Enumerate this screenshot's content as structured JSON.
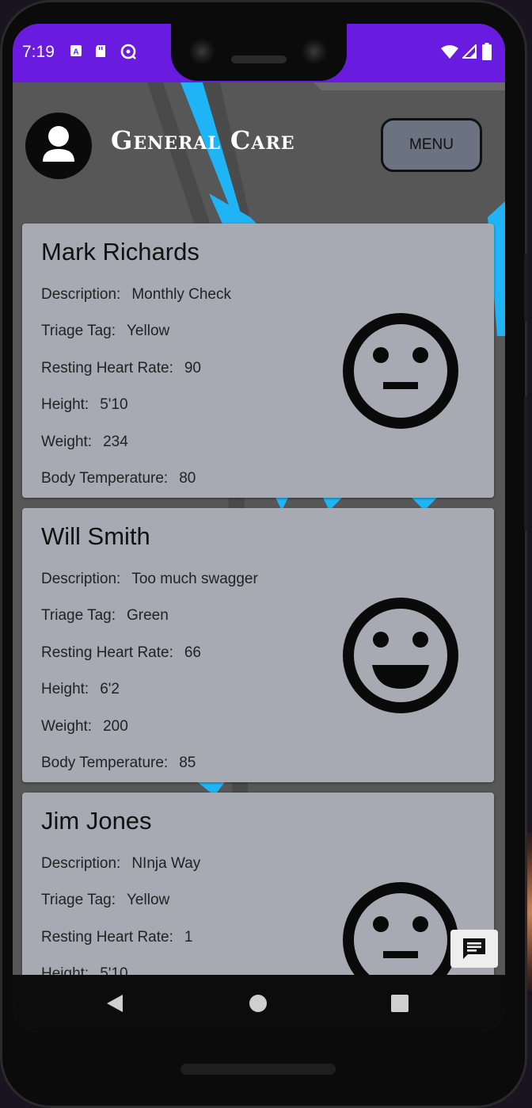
{
  "status": {
    "time": "7:19"
  },
  "header": {
    "title": "General Care",
    "menu_label": "MENU"
  },
  "labels": {
    "description": "Description:",
    "triage": "Triage Tag:",
    "heart_rate": "Resting Heart Rate:",
    "height": "Height:",
    "weight": "Weight:",
    "temperature": "Body Temperature:"
  },
  "patients": [
    {
      "name": "Mark Richards",
      "description": "Monthly Check",
      "triage": "Yellow",
      "heart_rate": "90",
      "height": "5'10",
      "weight": "234",
      "temperature": "80",
      "face_icon": "neutral-face-icon"
    },
    {
      "name": "Will Smith",
      "description": "Too much swagger",
      "triage": "Green",
      "heart_rate": "66",
      "height": "6'2",
      "weight": "200",
      "temperature": "85",
      "face_icon": "happy-face-icon"
    },
    {
      "name": "Jim Jones",
      "description": "NInja Way",
      "triage": "Yellow",
      "heart_rate": "1",
      "height": "5'10",
      "face_icon": "neutral-face-icon"
    }
  ],
  "colors": {
    "status_bar": "#6a1be0",
    "card": "#a8aab3",
    "accent_stripe": "#1fb4f5"
  }
}
